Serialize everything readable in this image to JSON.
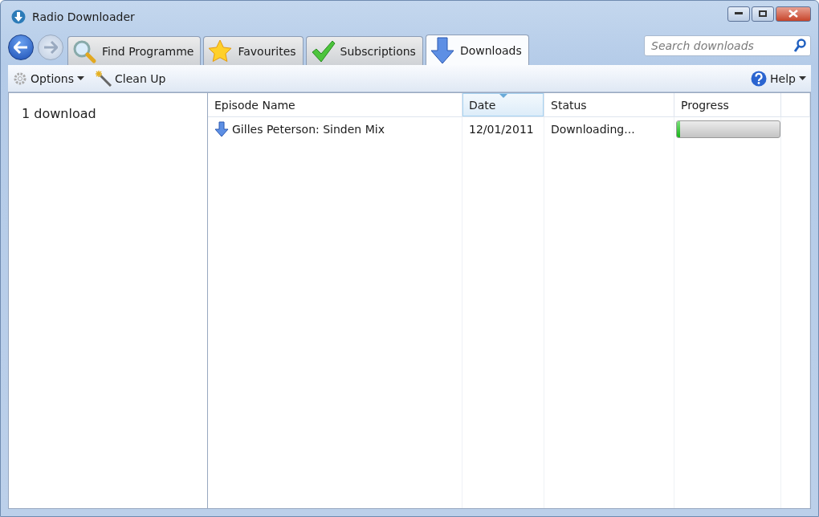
{
  "window": {
    "title": "Radio Downloader"
  },
  "navigation": {
    "back_disabled": false,
    "forward_disabled": true
  },
  "tabs": [
    {
      "label": "Find Programme",
      "kind": "search",
      "selected": false
    },
    {
      "label": "Favourites",
      "kind": "star",
      "selected": false
    },
    {
      "label": "Subscriptions",
      "kind": "tick",
      "selected": false
    },
    {
      "label": "Downloads",
      "kind": "download",
      "selected": true
    }
  ],
  "search": {
    "placeholder": "Search downloads"
  },
  "toolbar": {
    "options": "Options",
    "clean_up": "Clean Up",
    "help": "Help"
  },
  "sidebar": {
    "summary": "1 download"
  },
  "table": {
    "columns": [
      {
        "label": "Episode Name",
        "sorted": false
      },
      {
        "label": "Date",
        "sorted": true
      },
      {
        "label": "Status",
        "sorted": false
      },
      {
        "label": "Progress",
        "sorted": false
      }
    ],
    "rows": [
      {
        "episode": "Gilles Peterson: Sinden Mix",
        "date": "12/01/2011",
        "status": "Downloading...",
        "level": 0.03
      }
    ]
  }
}
